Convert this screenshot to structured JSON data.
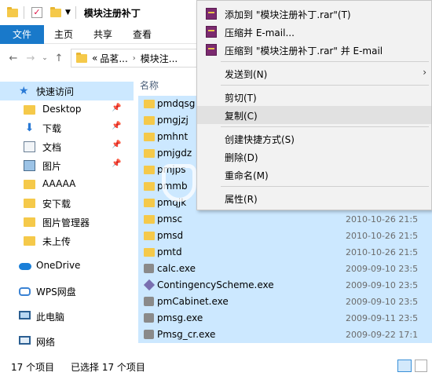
{
  "window": {
    "title": "模块注册补丁"
  },
  "ribbon": {
    "tabs": [
      "文件",
      "主页",
      "共享",
      "查看"
    ]
  },
  "address": {
    "overflow": "«",
    "crumbs": [
      "品茗...",
      "模块注..."
    ]
  },
  "nav_pane": {
    "items": [
      {
        "label": "快速访问",
        "icon": "star-icon",
        "pinned": false
      },
      {
        "label": "Desktop",
        "icon": "folder-icon",
        "pinned": true
      },
      {
        "label": "下载",
        "icon": "download-icon",
        "pinned": true
      },
      {
        "label": "文档",
        "icon": "document-icon",
        "pinned": true
      },
      {
        "label": "图片",
        "icon": "picture-icon",
        "pinned": true
      },
      {
        "label": "AAAAA",
        "icon": "folder-icon",
        "pinned": false
      },
      {
        "label": "安下载",
        "icon": "folder-icon",
        "pinned": false
      },
      {
        "label": "图片管理器",
        "icon": "folder-icon",
        "pinned": false
      },
      {
        "label": "未上传",
        "icon": "folder-icon",
        "pinned": false
      },
      {
        "label": "OneDrive",
        "icon": "cloud-icon",
        "pinned": false
      },
      {
        "label": "WPS网盘",
        "icon": "wps-cloud-icon",
        "pinned": false
      },
      {
        "label": "此电脑",
        "icon": "computer-icon",
        "pinned": false
      },
      {
        "label": "网络",
        "icon": "network-icon",
        "pinned": false
      }
    ]
  },
  "file_list": {
    "column_header": "名称",
    "files": [
      {
        "name": "pmdqsg",
        "date": "",
        "type": "folder"
      },
      {
        "name": "pmgjzj",
        "date": "",
        "type": "folder"
      },
      {
        "name": "pmhnt",
        "date": "",
        "type": "folder"
      },
      {
        "name": "pmjgdz",
        "date": "",
        "type": "folder"
      },
      {
        "name": "pmjps",
        "date": "",
        "type": "folder"
      },
      {
        "name": "pmmb",
        "date": "",
        "type": "folder"
      },
      {
        "name": "pmqjk",
        "date": "",
        "type": "folder"
      },
      {
        "name": "pmsc",
        "date": "2010-10-26 21:5",
        "type": "folder"
      },
      {
        "name": "pmsd",
        "date": "2010-10-26 21:5",
        "type": "folder"
      },
      {
        "name": "pmtd",
        "date": "2010-10-26 21:5",
        "type": "folder"
      },
      {
        "name": "calc.exe",
        "date": "2009-09-10 23:5",
        "type": "exe"
      },
      {
        "name": "ContingencyScheme.exe",
        "date": "2009-09-10 23:5",
        "type": "exe2"
      },
      {
        "name": "pmCabinet.exe",
        "date": "2009-09-10 23:5",
        "type": "exe"
      },
      {
        "name": "pmsg.exe",
        "date": "2009-09-11 23:5",
        "type": "exe"
      },
      {
        "name": "Pmsg_cr.exe",
        "date": "2009-09-22 17:1",
        "type": "exe"
      }
    ]
  },
  "status": {
    "count": "17 个项目",
    "selected": "已选择 17 个项目"
  },
  "context_menu": {
    "items": [
      {
        "label": "添加到 \"模块注册补丁.rar\"(T)",
        "icon": "winrar-icon"
      },
      {
        "label": "压缩并 E-mail...",
        "icon": "winrar-icon"
      },
      {
        "label": "压缩到 \"模块注册补丁.rar\" 并 E-mail",
        "icon": "winrar-icon"
      },
      {
        "label": "发送到(N)",
        "submenu": true
      },
      {
        "label": "剪切(T)"
      },
      {
        "label": "复制(C)",
        "highlighted": true
      },
      {
        "label": "创建快捷方式(S)"
      },
      {
        "label": "删除(D)"
      },
      {
        "label": "重命名(M)"
      },
      {
        "label": "属性(R)"
      }
    ]
  },
  "watermark": {
    "text": "安下载",
    "sub": "anxz.com"
  },
  "colors": {
    "accent": "#1979ca",
    "selection": "#cce8ff",
    "folder": "#f5c94a"
  }
}
